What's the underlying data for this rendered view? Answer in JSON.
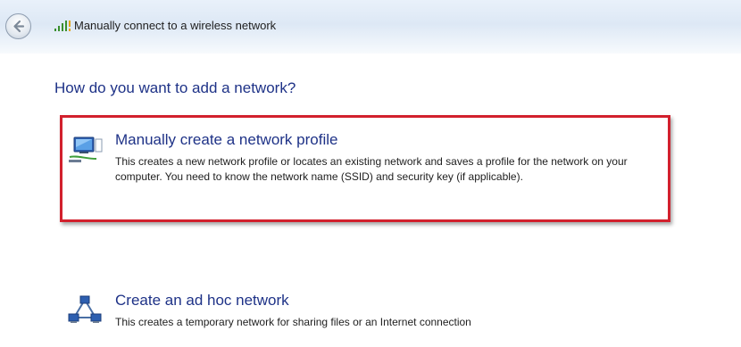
{
  "window": {
    "title": "Manually connect to a wireless network",
    "back_icon": "back-arrow-icon",
    "title_icon": "wireless-signal-icon"
  },
  "main": {
    "heading": "How do you want to add a network?",
    "options": [
      {
        "title": "Manually create a network profile",
        "description": "This creates a new network profile or locates an existing network and saves a profile for the network on your computer. You need to know the network name (SSID) and security key (if applicable).",
        "icon": "network-profile-icon",
        "highlighted": true,
        "highlight_color": "#d2202d"
      },
      {
        "title": "Create an ad hoc network",
        "description": "This creates a temporary network for sharing files or an Internet connection",
        "icon": "ad-hoc-network-icon",
        "highlighted": false
      }
    ]
  },
  "colors": {
    "link_blue": "#1e3287",
    "text": "#202020",
    "titlebar": "#dde8f5"
  }
}
